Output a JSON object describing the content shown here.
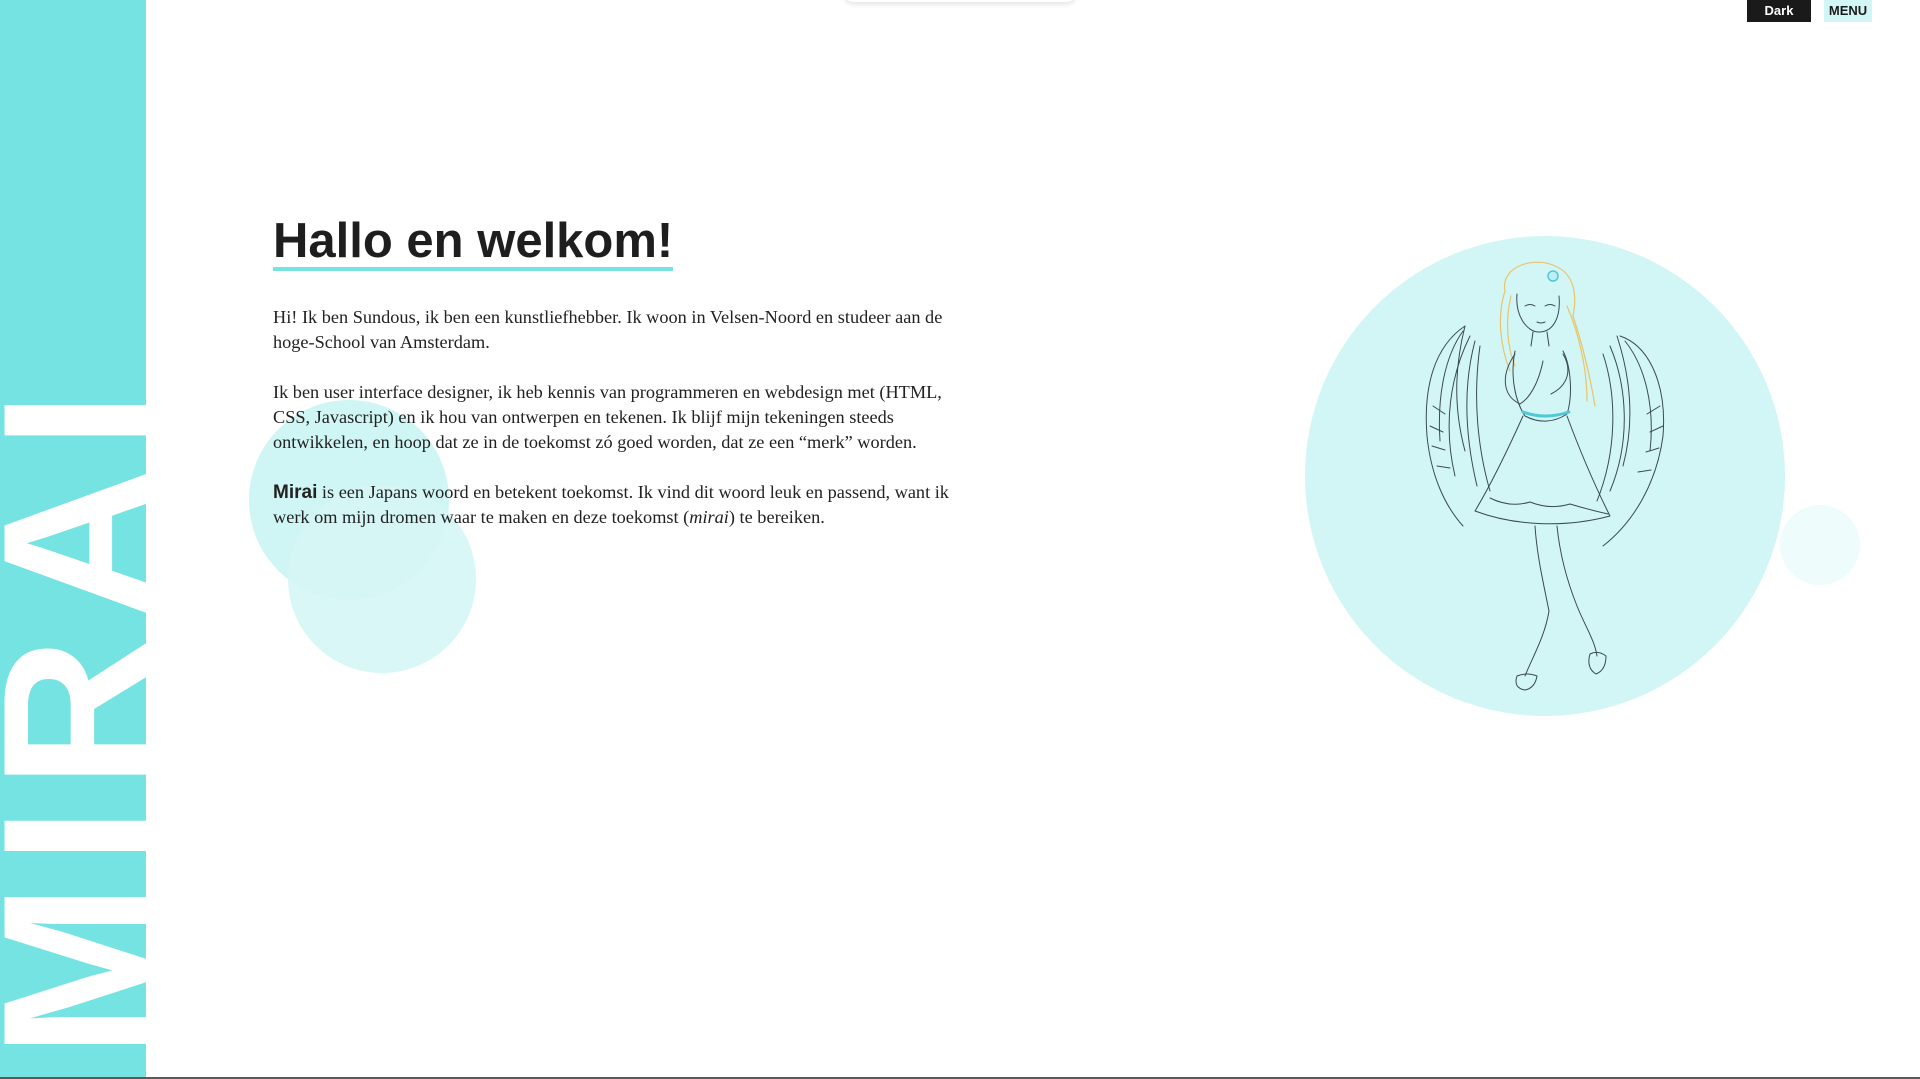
{
  "sidebar": {
    "title": "MIRAI"
  },
  "header": {
    "dark_toggle_label": "Dark",
    "menu_label": "MENU"
  },
  "main": {
    "title": "Hallo en welkom!",
    "paragraph_1": "Hi! Ik ben Sundous, ik ben een kunstliefhebber. Ik woon in Velsen-Noord en studeer aan de hoge-School van Amsterdam.",
    "paragraph_2": "Ik ben user interface designer, ik heb kennis van programmeren en webdesign met (HTML, CSS, Javascript) en ik hou van ontwerpen en tekenen. Ik blijf mijn tekeningen steeds ontwikkelen, en hoop dat ze in de toekomst zó goed worden, dat ze een “merk” worden.",
    "paragraph_3": {
      "brand": "Mirai",
      "text_before_em": " is een Japans woord en betekent toekomst. Ik vind dit woord leuk en passend, want ik werk om mijn dromen waar te maken en deze toekomst (",
      "em": "mirai",
      "text_after_em": ") te bereiken."
    }
  },
  "hero": {
    "illustration": "angel-girl-line-drawing"
  },
  "colors": {
    "accent": "#74e3e2",
    "accent_light": "#d2f6f6",
    "dark_button": "#1a1a1a"
  }
}
